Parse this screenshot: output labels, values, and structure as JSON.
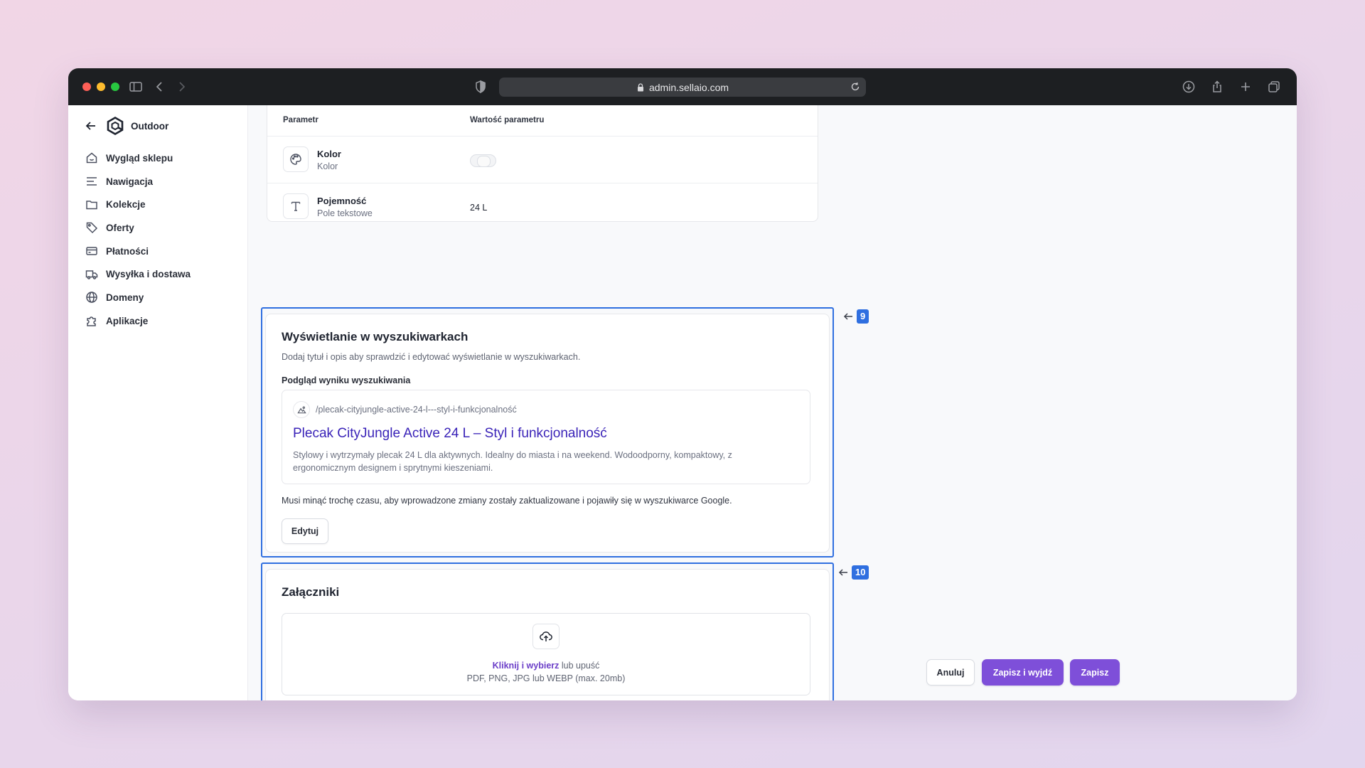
{
  "browser": {
    "url": "admin.sellaio.com"
  },
  "sidebar": {
    "store_name": "Outdoor",
    "items": [
      {
        "label": "Wygląd sklepu",
        "icon": "home-icon"
      },
      {
        "label": "Nawigacja",
        "icon": "menu-lines-icon"
      },
      {
        "label": "Kolekcje",
        "icon": "folder-icon"
      },
      {
        "label": "Oferty",
        "icon": "tag-icon"
      },
      {
        "label": "Płatności",
        "icon": "credit-card-icon"
      },
      {
        "label": "Wysyłka i dostawa",
        "icon": "truck-icon"
      },
      {
        "label": "Domeny",
        "icon": "globe-icon"
      },
      {
        "label": "Aplikacje",
        "icon": "puzzle-icon"
      }
    ]
  },
  "parameters": {
    "header_param": "Parametr",
    "header_value": "Wartość parametru",
    "rows": [
      {
        "name": "Kolor",
        "type": "Kolor",
        "value": "",
        "icon": "palette-icon"
      },
      {
        "name": "Pojemność",
        "type": "Pole tekstowe",
        "value": "24 L",
        "icon": "text-t-icon"
      }
    ]
  },
  "markers": {
    "seo": "9",
    "attachments": "10"
  },
  "seo": {
    "title": "Wyświetlanie w wyszukiwarkach",
    "description": "Dodaj tytuł i opis aby sprawdzić i edytować wyświetlanie w wyszukiwarkach.",
    "preview_label": "Podgląd wyniku wyszukiwania",
    "preview_url": "/plecak-cityjungle-active-24-l---styl-i-funkcjonalność",
    "preview_title": "Plecak CityJungle Active 24 L – Styl i funkcjonalność",
    "preview_description": "Stylowy i wytrzymały plecak 24 L dla aktywnych. Idealny do miasta i na weekend. Wodoodporny, kompaktowy, z ergonomicznym designem i sprytnymi kieszeniami.",
    "note": "Musi minąć trochę czasu, aby wprowadzone zmiany zostały zaktualizowane i pojawiły się w wyszukiwarce Google.",
    "edit_button": "Edytuj"
  },
  "attachments": {
    "title": "Załączniki",
    "link_text": "Kliknij i wybierz",
    "drop_text": " lub upuść",
    "formats": "PDF, PNG, JPG lub WEBP (max. 20mb)"
  },
  "footer": {
    "cancel": "Anuluj",
    "save_exit": "Zapisz i wyjdź",
    "save": "Zapisz"
  },
  "colors": {
    "accent": "#7e4fd9",
    "highlight": "#2f6fe0",
    "link_title": "#3a23b8"
  }
}
